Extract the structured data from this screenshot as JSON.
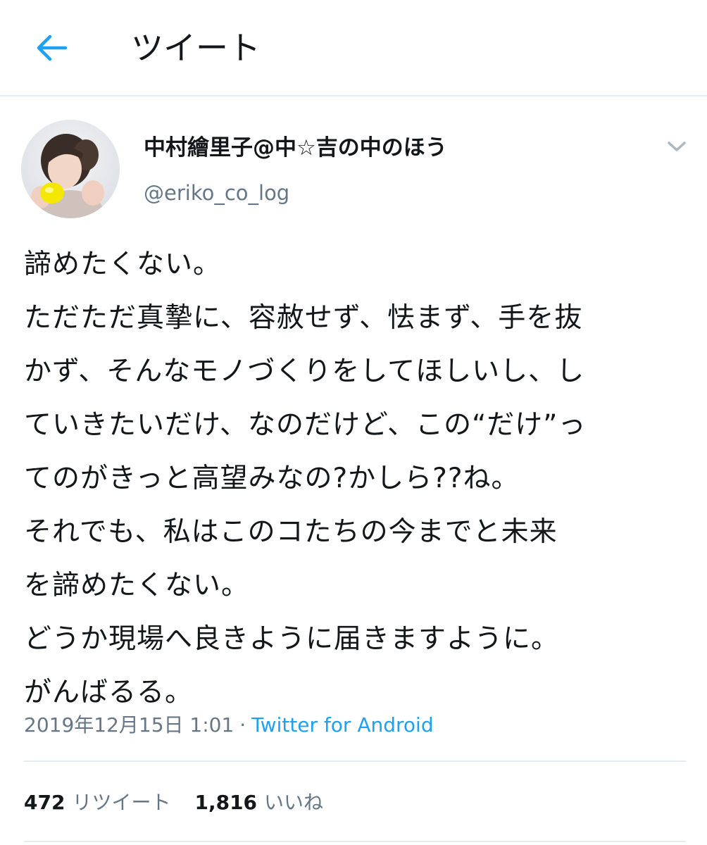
{
  "header": {
    "title": "ツイート",
    "back_icon": "arrow-left-icon",
    "accent_color": "#1da1f2"
  },
  "author": {
    "display_name": "中村繪里子@中☆吉の中のほう",
    "handle": "@eriko_co_log",
    "avatar_icon": "avatar-photo",
    "menu_icon": "chevron-down-icon"
  },
  "tweet": {
    "lines": [
      "諦めたくない。",
      "ただただ真摯に、容赦せず、怯まず、手を抜",
      "かず、そんなモノづくりをしてほしいし、し",
      "ていきたいだけ、なのだけど、この“だけ”っ",
      "てのがきっと高望みなの?かしら??ね。",
      "それでも、私はこのコたちの今までと未来",
      "を諦めたくない。",
      "どうか現場へ良きように届きますように。",
      "がんばるる。"
    ],
    "timestamp": "2019年12月15日 1:01",
    "separator": "·",
    "source": "Twitter for Android"
  },
  "stats": {
    "retweets_count": "472",
    "retweets_label": "リツイート",
    "likes_count": "1,816",
    "likes_label": "いいね"
  }
}
